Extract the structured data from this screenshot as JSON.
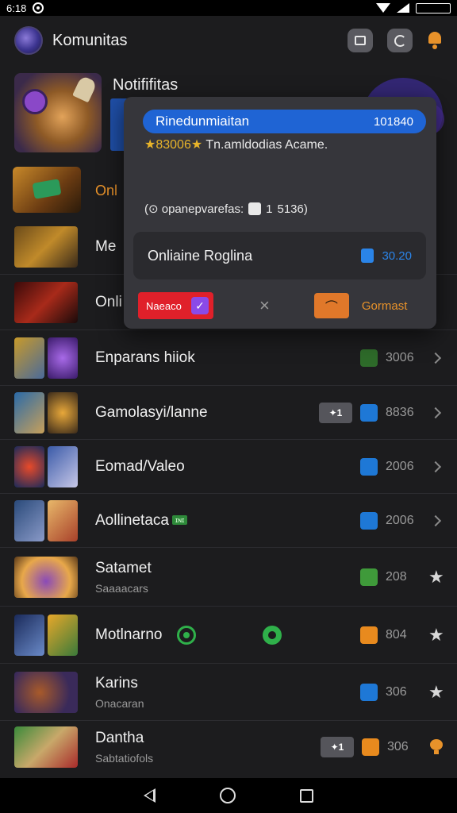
{
  "status": {
    "time": "6:18",
    "battery": ""
  },
  "header": {
    "title": "Komunitas"
  },
  "hero": {
    "title": "Notififitas"
  },
  "promo": {
    "label": "Onl"
  },
  "popup": {
    "bar_title": "Rinedunmiaitan",
    "bar_value": "101840",
    "subtitle_stars": "★83006★",
    "subtitle_text": "Tn.amldodias Acame.",
    "meta_prefix": "(⊙ opanepvarefas:",
    "meta_count": "1",
    "meta_suffix": "5136)",
    "card_title": "Onliaine Roglina",
    "card_value": "30.20",
    "red_button_label": "Naeaco",
    "close_label": "×",
    "action_label": "Gormast"
  },
  "list": [
    {
      "title": "Me",
      "sub": "",
      "pill": "",
      "count": "",
      "icon": "",
      "trail": ""
    },
    {
      "title": "Onli",
      "sub": "",
      "pill": "",
      "count": "",
      "icon": "",
      "trail": ""
    },
    {
      "title": "Enparans hiiok",
      "sub": "",
      "pill": "",
      "count": "3006",
      "icon": "darkgreen",
      "trail": "chevron"
    },
    {
      "title": "Gamolasyi/lanne",
      "sub": "",
      "pill": "✦1",
      "count": "8836",
      "icon": "blue",
      "trail": "chevron"
    },
    {
      "title": "Eomad/Valeo",
      "sub": "",
      "pill": "",
      "count": "2006",
      "icon": "blue",
      "trail": "chevron"
    },
    {
      "title": "Aollinetaca",
      "badge": "ɪɴɪ",
      "sub": "",
      "pill": "",
      "count": "2006",
      "icon": "blue",
      "trail": "chevron"
    },
    {
      "title": "Satamet",
      "sub": "Saaaacars",
      "pill": "",
      "count": "208",
      "icon": "green",
      "trail": "star"
    },
    {
      "title": "Motlnarno",
      "sub": "",
      "pill": "",
      "count": "804",
      "icon": "orange",
      "trail": "star"
    },
    {
      "title": "Karins",
      "sub": "Onacaran",
      "pill": "",
      "count": "306",
      "icon": "blue",
      "trail": "star"
    },
    {
      "title": "Dantha",
      "sub": "Sabtatiofols",
      "pill": "✦1",
      "count": "306",
      "icon": "orange",
      "trail": "bulb"
    }
  ],
  "colors": {
    "accent": "#1f64d4",
    "orange": "#e8922a",
    "bg": "#1c1c1e"
  }
}
